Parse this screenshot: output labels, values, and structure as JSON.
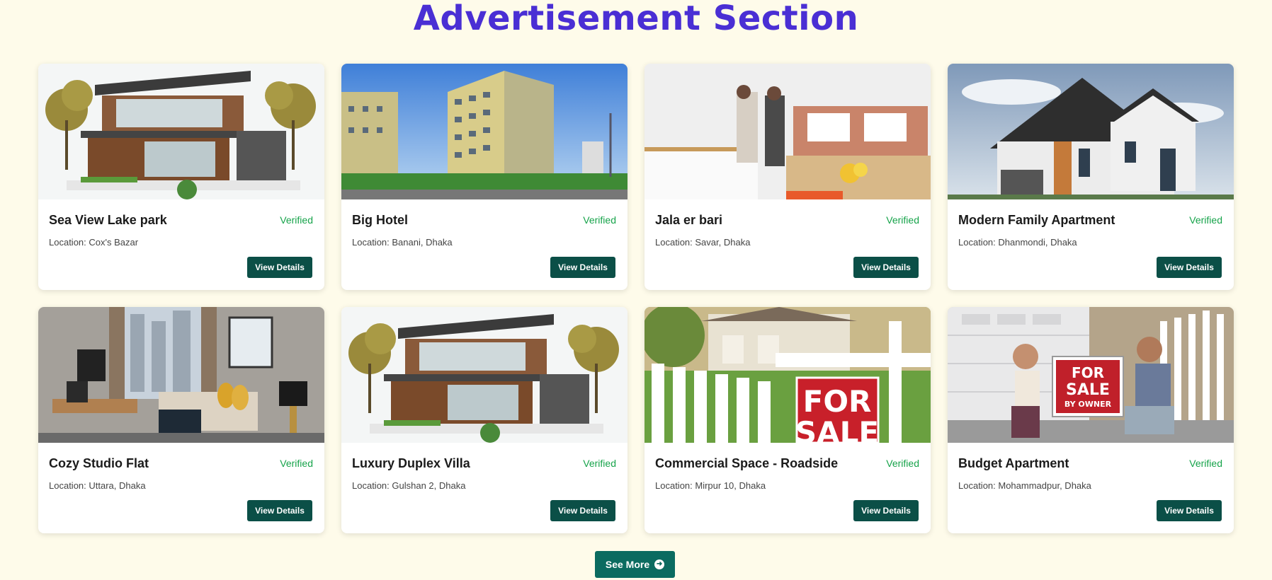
{
  "section": {
    "title": "Advertisement  Section"
  },
  "cards": [
    {
      "title": "Sea View Lake park",
      "badge": "Verified",
      "location": "Location: Cox's Bazar",
      "button": "View Details",
      "image": "modern-house-image"
    },
    {
      "title": "Big Hotel",
      "badge": "Verified",
      "location": "Location: Banani, Dhaka",
      "button": "View Details",
      "image": "apartment-building-image"
    },
    {
      "title": "Jala er bari",
      "badge": "Verified",
      "location": "Location: Savar, Dhaka",
      "button": "View Details",
      "image": "kitchen-people-image"
    },
    {
      "title": "Modern Family Apartment",
      "badge": "Verified",
      "location": "Location: Dhanmondi, Dhaka",
      "button": "View Details",
      "image": "family-house-image"
    },
    {
      "title": "Cozy Studio Flat",
      "badge": "Verified",
      "location": "Location: Uttara, Dhaka",
      "button": "View Details",
      "image": "living-room-image"
    },
    {
      "title": "Luxury Duplex Villa",
      "badge": "Verified",
      "location": "Location: Gulshan 2, Dhaka",
      "button": "View Details",
      "image": "modern-house-image"
    },
    {
      "title": "Commercial Space - Roadside",
      "badge": "Verified",
      "location": "Location: Mirpur 10, Dhaka",
      "button": "View Details",
      "image": "for-sale-sign-image"
    },
    {
      "title": "Budget Apartment",
      "badge": "Verified",
      "location": "Location: Mohammadpur, Dhaka",
      "button": "View Details",
      "image": "couple-sale-sign-image"
    }
  ],
  "signs": {
    "for": "FOR",
    "sale": "SALE",
    "by_owner": "BY OWNER"
  },
  "see_more": {
    "label": "See More",
    "icon": "arrow-right-circle-icon"
  },
  "colors": {
    "title": "#4a2fd4",
    "verified": "#16a34a",
    "button": "#0b4f47",
    "background": "#fefbea"
  }
}
